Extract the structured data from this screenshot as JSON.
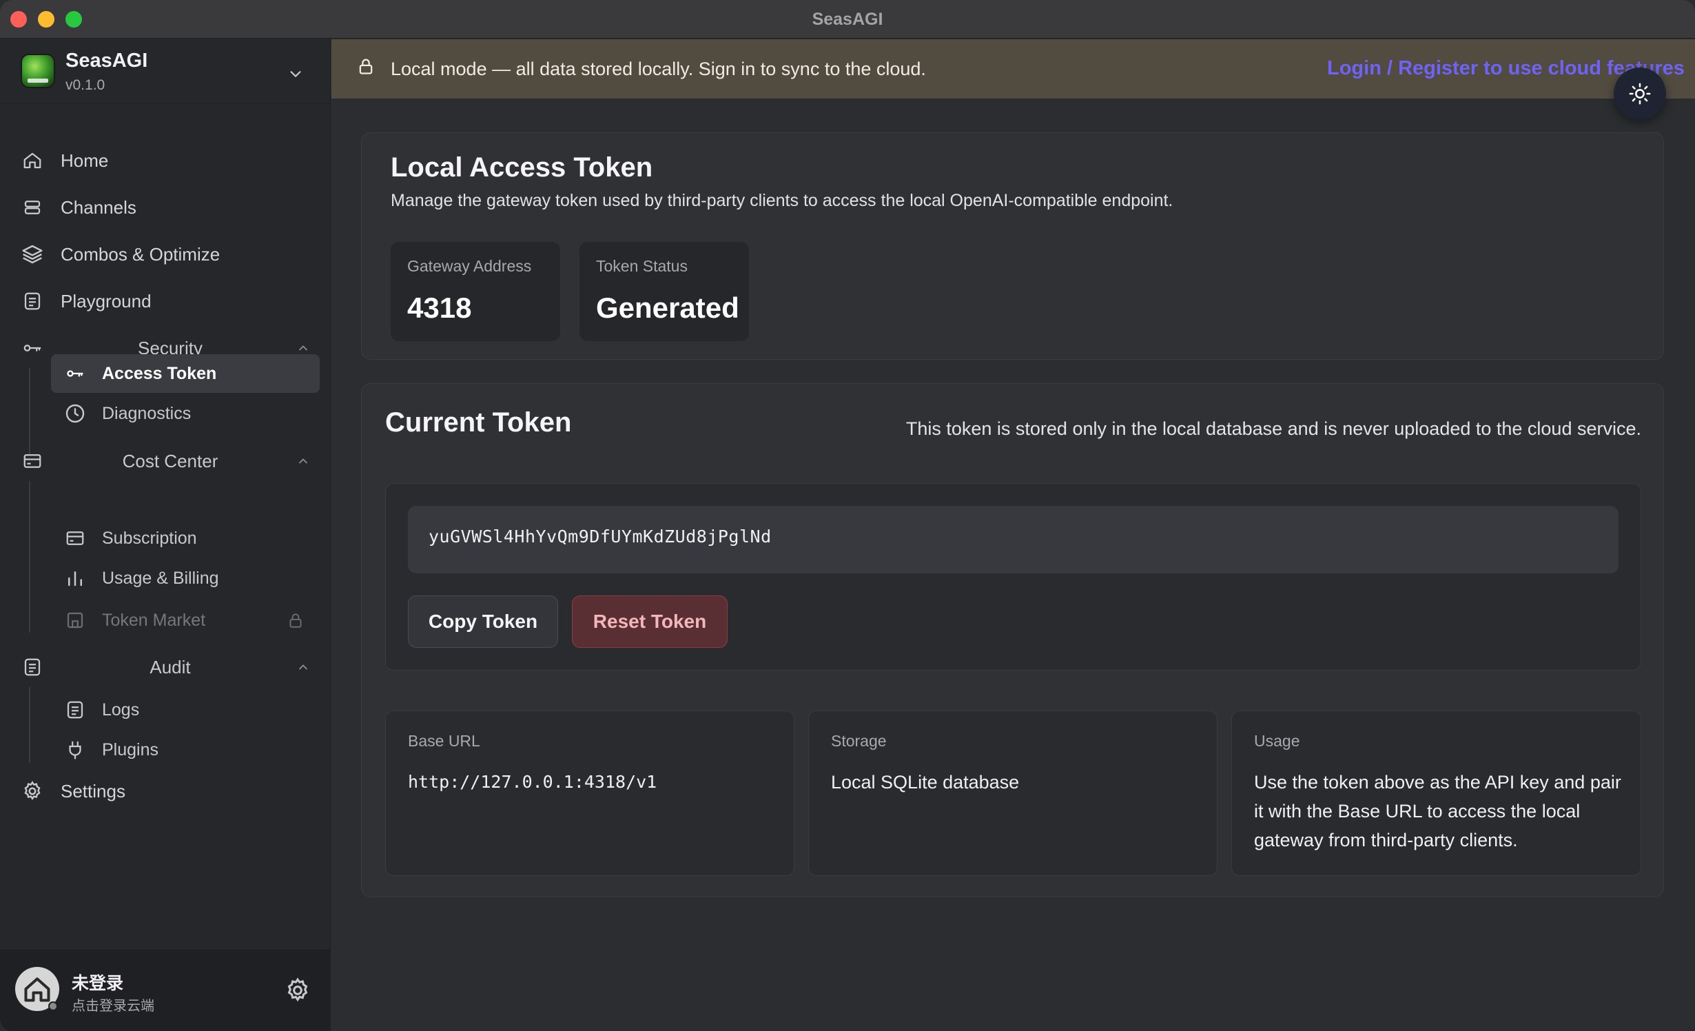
{
  "window": {
    "title": "SeasAGI"
  },
  "brand": {
    "name": "SeasAGI",
    "version": "v0.1.0"
  },
  "nav": {
    "home": "Home",
    "channels": "Channels",
    "combos": "Combos & Optimize",
    "playground": "Playground",
    "security": "Security",
    "access_token": "Access Token",
    "diagnostics": "Diagnostics",
    "cost_center": "Cost Center",
    "subscription": "Subscription",
    "usage_billing": "Usage & Billing",
    "token_market": "Token Market",
    "audit": "Audit",
    "logs": "Logs",
    "plugins": "Plugins",
    "settings": "Settings"
  },
  "user": {
    "name": "未登录",
    "subtitle": "点击登录云端"
  },
  "banner": {
    "text": "Local mode — all data stored locally. Sign in to sync to the cloud.",
    "link": "Login / Register to use cloud features"
  },
  "token_page": {
    "title": "Local Access Token",
    "description": "Manage the gateway token used by third-party clients to access the local OpenAI-compatible endpoint.",
    "gateway_label": "Gateway Address",
    "gateway_value": "4318",
    "status_label": "Token Status",
    "status_value": "Generated"
  },
  "current_token": {
    "title": "Current Token",
    "note": "This token is stored only in the local database and is never uploaded to the cloud service.",
    "value": "yuGVWSl4HhYvQm9DfUYmKdZUd8jPglNd",
    "copy_label": "Copy Token",
    "reset_label": "Reset Token"
  },
  "info": {
    "base_url_label": "Base URL",
    "base_url_value": "http://127.0.0.1:4318/v1",
    "storage_label": "Storage",
    "storage_value": "Local SQLite database",
    "usage_label": "Usage",
    "usage_value": "Use the token above as the API key and pair it with the Base URL to access the local gateway from third-party clients."
  },
  "colors": {
    "accent_link": "#6e63f6",
    "danger": "#f3b6bb",
    "banner_bg": "#524c40"
  }
}
